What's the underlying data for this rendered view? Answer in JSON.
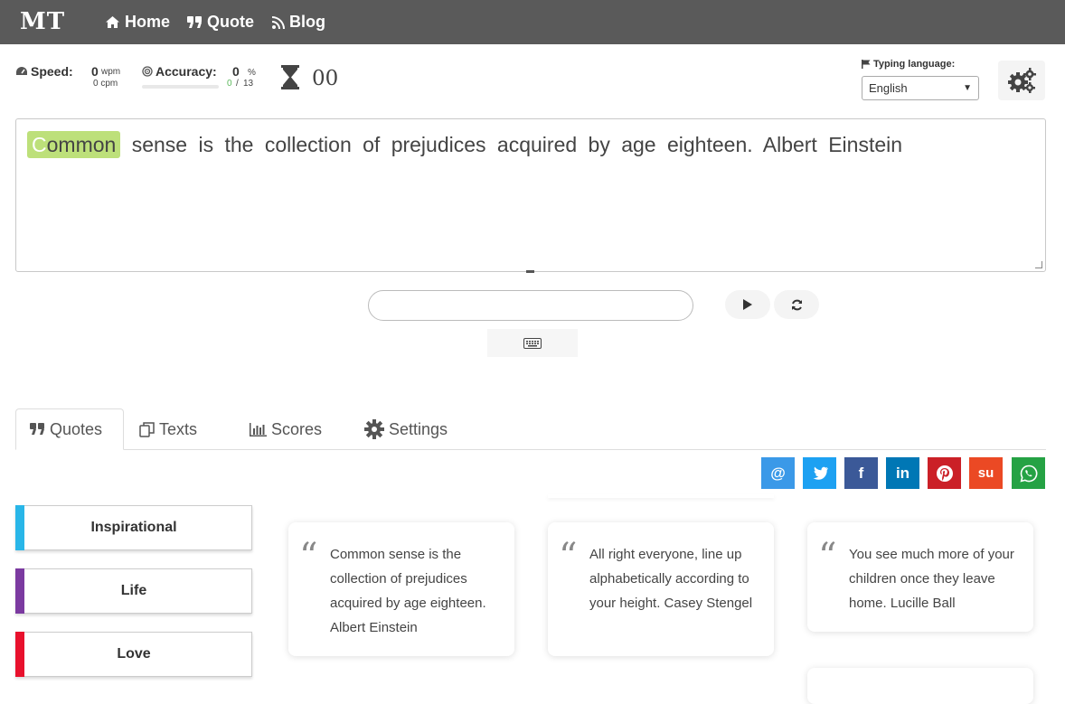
{
  "header": {
    "logo": "MT",
    "nav": [
      {
        "label": "Home",
        "icon": "home-icon"
      },
      {
        "label": "Quote",
        "icon": "quote-icon"
      },
      {
        "label": "Blog",
        "icon": "rss-icon"
      }
    ]
  },
  "stats": {
    "speed_label": "Speed:",
    "speed_wpm_value": "0",
    "speed_wpm_unit": "wpm",
    "speed_cpm": "0 cpm",
    "accuracy_label": "Accuracy:",
    "accuracy_value": "0",
    "accuracy_unit": "%",
    "accuracy_correct": "0",
    "accuracy_sep": "/",
    "accuracy_total": "13",
    "timer": "00"
  },
  "language": {
    "label": "Typing language:",
    "selected": "English"
  },
  "exercise": {
    "current_word": "Common",
    "current_letter": "C",
    "current_rest": "ommon",
    "remaining_text": " sense is the collection of prejudices acquired by age eighteen. Albert Einstein"
  },
  "input": {
    "placeholder": ""
  },
  "tabs": [
    {
      "label": "Quotes",
      "icon": "quote-icon"
    },
    {
      "label": "Texts",
      "icon": "copy-icon"
    },
    {
      "label": "Scores",
      "icon": "bar-chart-icon"
    },
    {
      "label": "Settings",
      "icon": "gear-icon"
    }
  ],
  "share": [
    {
      "glyph": "@",
      "name": "email",
      "color": "#3b99e8"
    },
    {
      "glyph": "t",
      "name": "twitter",
      "color": "#1da1f2"
    },
    {
      "glyph": "f",
      "name": "facebook",
      "color": "#3b5998"
    },
    {
      "glyph": "in",
      "name": "linkedin",
      "color": "#0077b5"
    },
    {
      "glyph": "P",
      "name": "pinterest",
      "color": "#cb2027"
    },
    {
      "glyph": "su",
      "name": "stumbleupon",
      "color": "#eb4924"
    },
    {
      "glyph": "W",
      "name": "whatsapp",
      "color": "#25a244"
    }
  ],
  "categories": [
    {
      "label": "Inspirational",
      "color": "#29b6e8"
    },
    {
      "label": "Life",
      "color": "#7b3aa0"
    },
    {
      "label": "Love",
      "color": "#e8112d"
    }
  ],
  "quotes": [
    "Common sense is the collection of prejudices acquired by age eighteen. Albert Einstein",
    "All right everyone, line up alphabetically according to your height. Casey Stengel",
    "You see much more of your children once they leave home. Lucille Ball"
  ]
}
